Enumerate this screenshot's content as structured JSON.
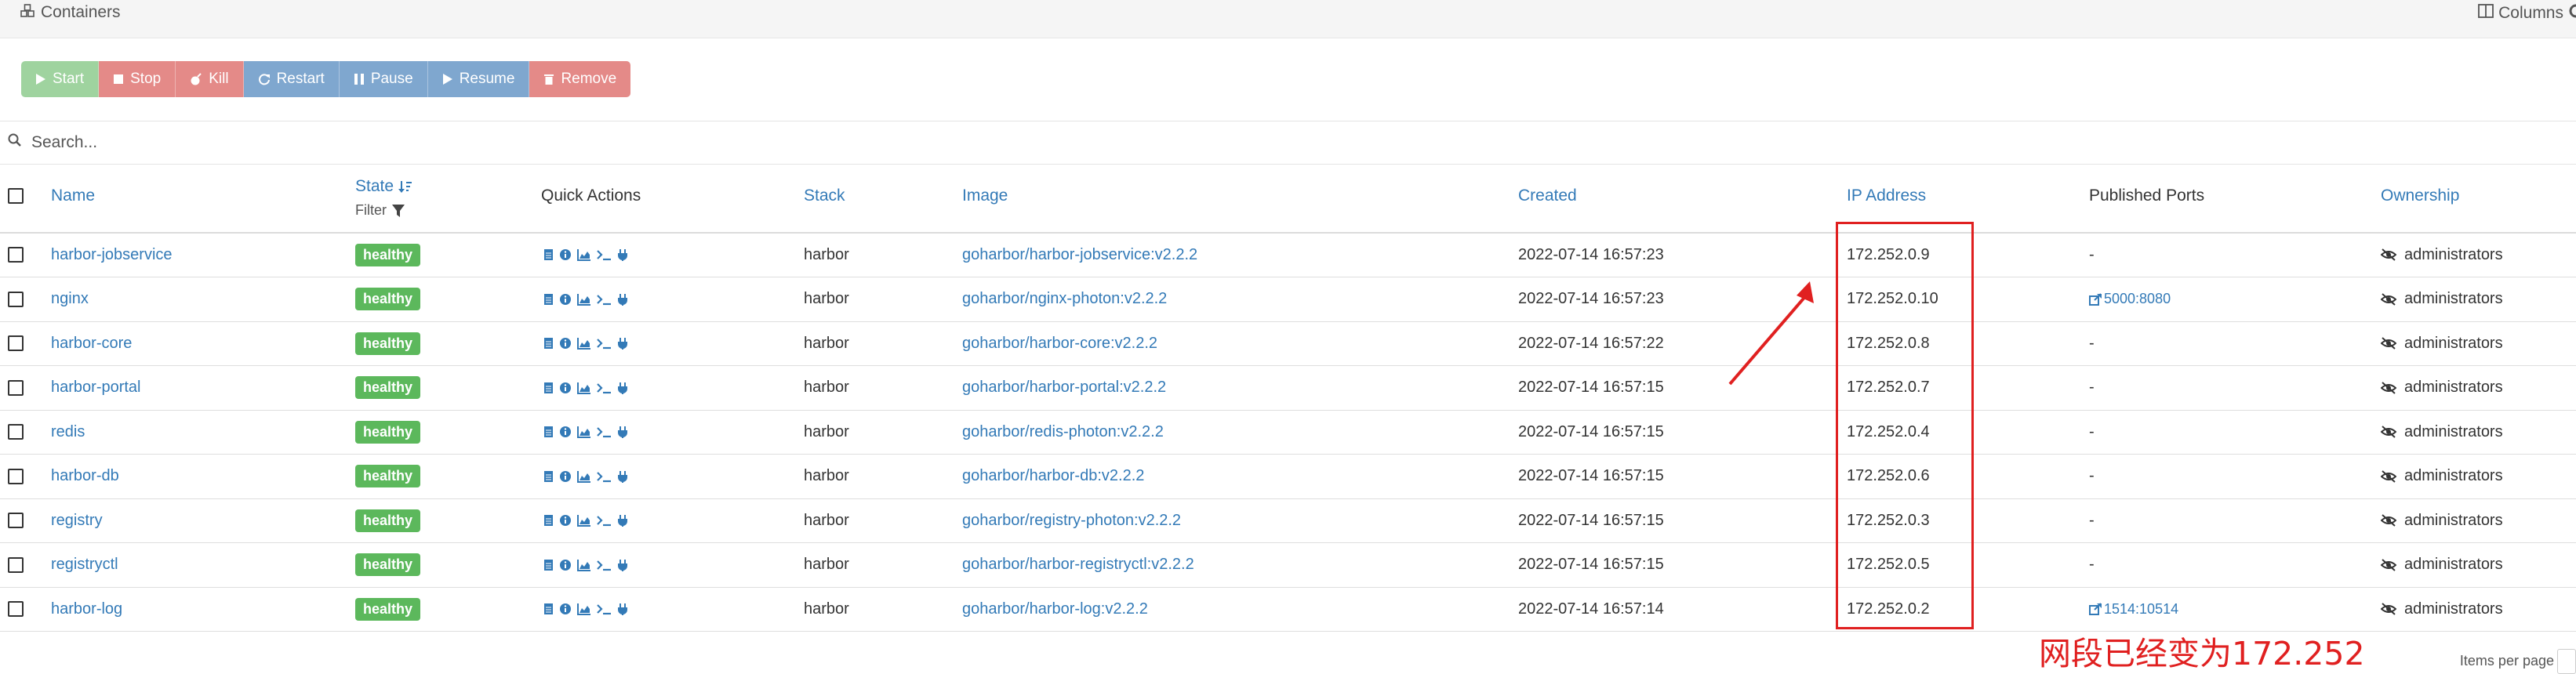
{
  "header": {
    "title": "Containers",
    "columns_label": "Columns"
  },
  "toolbar": {
    "start": "Start",
    "stop": "Stop",
    "kill": "Kill",
    "restart": "Restart",
    "pause": "Pause",
    "resume": "Resume",
    "remove": "Remove"
  },
  "search": {
    "placeholder": "Search..."
  },
  "table": {
    "headers": {
      "name": "Name",
      "state": "State",
      "filter": "Filter",
      "quick_actions": "Quick Actions",
      "stack": "Stack",
      "image": "Image",
      "created": "Created",
      "ip": "IP Address",
      "ports": "Published Ports",
      "ownership": "Ownership"
    },
    "rows": [
      {
        "name": "harbor-jobservice",
        "state": "healthy",
        "stack": "harbor",
        "image": "goharbor/harbor-jobservice:v2.2.2",
        "created": "2022-07-14 16:57:23",
        "ip": "172.252.0.9",
        "ports": "-",
        "ownership": "administrators"
      },
      {
        "name": "nginx",
        "state": "healthy",
        "stack": "harbor",
        "image": "goharbor/nginx-photon:v2.2.2",
        "created": "2022-07-14 16:57:23",
        "ip": "172.252.0.10",
        "ports": "5000:8080",
        "ownership": "administrators"
      },
      {
        "name": "harbor-core",
        "state": "healthy",
        "stack": "harbor",
        "image": "goharbor/harbor-core:v2.2.2",
        "created": "2022-07-14 16:57:22",
        "ip": "172.252.0.8",
        "ports": "-",
        "ownership": "administrators"
      },
      {
        "name": "harbor-portal",
        "state": "healthy",
        "stack": "harbor",
        "image": "goharbor/harbor-portal:v2.2.2",
        "created": "2022-07-14 16:57:15",
        "ip": "172.252.0.7",
        "ports": "-",
        "ownership": "administrators"
      },
      {
        "name": "redis",
        "state": "healthy",
        "stack": "harbor",
        "image": "goharbor/redis-photon:v2.2.2",
        "created": "2022-07-14 16:57:15",
        "ip": "172.252.0.4",
        "ports": "-",
        "ownership": "administrators"
      },
      {
        "name": "harbor-db",
        "state": "healthy",
        "stack": "harbor",
        "image": "goharbor/harbor-db:v2.2.2",
        "created": "2022-07-14 16:57:15",
        "ip": "172.252.0.6",
        "ports": "-",
        "ownership": "administrators"
      },
      {
        "name": "registry",
        "state": "healthy",
        "stack": "harbor",
        "image": "goharbor/registry-photon:v2.2.2",
        "created": "2022-07-14 16:57:15",
        "ip": "172.252.0.3",
        "ports": "-",
        "ownership": "administrators"
      },
      {
        "name": "registryctl",
        "state": "healthy",
        "stack": "harbor",
        "image": "goharbor/harbor-registryctl:v2.2.2",
        "created": "2022-07-14 16:57:15",
        "ip": "172.252.0.5",
        "ports": "-",
        "ownership": "administrators"
      },
      {
        "name": "harbor-log",
        "state": "healthy",
        "stack": "harbor",
        "image": "goharbor/harbor-log:v2.2.2",
        "created": "2022-07-14 16:57:14",
        "ip": "172.252.0.2",
        "ports": "1514:10514",
        "ownership": "administrators"
      }
    ]
  },
  "annotation": {
    "text": "网段已经变为172.252"
  },
  "footer": {
    "items_per_page": "Items per page"
  },
  "colors": {
    "link": "#337ab7",
    "healthy": "#5cb85c",
    "annotation": "#e02020"
  }
}
